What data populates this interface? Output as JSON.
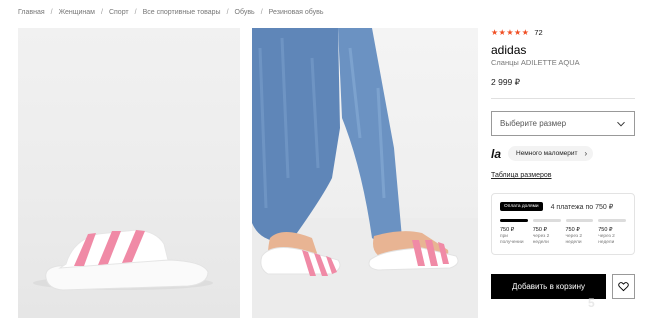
{
  "breadcrumbs": [
    "Главная",
    "Женщинам",
    "Спорт",
    "Все спортивные товары",
    "Обувь",
    "Резиновая обувь"
  ],
  "breadcrumb_separator": "/",
  "product": {
    "stars": "★★★★★",
    "rating_count": "72",
    "brand": "adidas",
    "model": "Сланцы ADILETTE AQUA",
    "price": "2 999 ₽"
  },
  "size_select": {
    "placeholder": "Выберите размер"
  },
  "fit": {
    "logo": "la",
    "label": "Немного маломерит"
  },
  "size_table_link": "Таблица размеров",
  "installment": {
    "badge": "Оплата долями",
    "summary": "4 платежа по 750 ₽",
    "paid_fraction": 0.25,
    "payments": [
      {
        "amount": "750 ₽",
        "when": "при получении"
      },
      {
        "amount": "750 ₽",
        "when": "через 2 недели"
      },
      {
        "amount": "750 ₽",
        "when": "через 2 недели"
      },
      {
        "amount": "750 ₽",
        "when": "через 2 недели"
      }
    ]
  },
  "cart_button": "Добавить в корзину",
  "colors": {
    "accent_stars": "#f04e23",
    "stripe_pink": "#f08aa6",
    "button_black": "#000000"
  },
  "icons": {
    "chevron": "chevron-down-icon",
    "favorite": "heart-icon"
  },
  "watermark": "5"
}
